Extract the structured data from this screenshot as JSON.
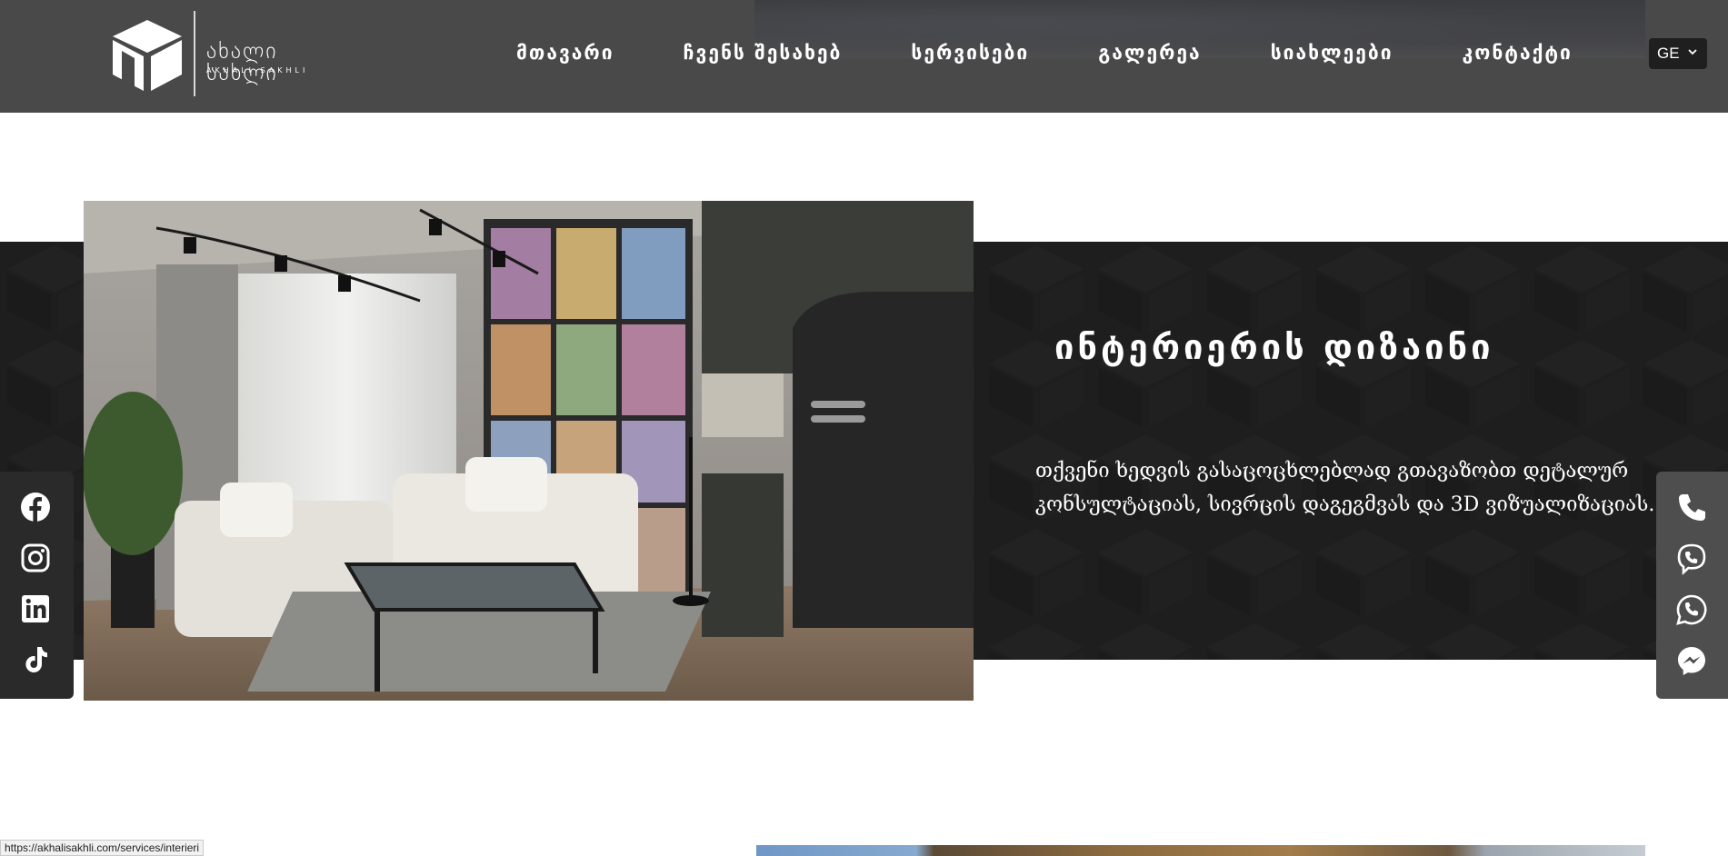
{
  "header": {
    "logo_text": "ახალი სახლი",
    "logo_sub": "AKHALI SAKHLI",
    "nav": [
      {
        "label": "მთავარი"
      },
      {
        "label": "ჩვენს შესახებ"
      },
      {
        "label": "სერვისები"
      },
      {
        "label": "გალერეა"
      },
      {
        "label": "სიახლეები"
      },
      {
        "label": "კონტაქტი"
      }
    ],
    "language": "GE"
  },
  "service": {
    "title": "ინტერიერის დიზაინი",
    "description": "თქვენი ხედვის გასაცოცხლებლად გთავაზობთ დეტალურ კონსულტაციას, სივრცის დაგეგმვას და 3D ვიზუალიზაციას."
  },
  "social": [
    "facebook-icon",
    "instagram-icon",
    "linkedin-icon",
    "tiktok-icon"
  ],
  "contact": [
    "phone-icon",
    "viber-icon",
    "whatsapp-icon",
    "messenger-icon"
  ],
  "status_bar": {
    "url": "https://akhalisakhli.com/services/interieri"
  },
  "colors": {
    "header_bg": "#4a4a4a",
    "band_bg": "#1e1e1e",
    "text": "#ffffff"
  }
}
